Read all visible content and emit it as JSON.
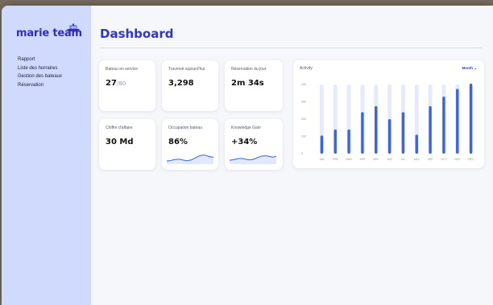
{
  "app": {
    "logo": "marie team"
  },
  "sidebar": {
    "items": [
      {
        "label": "Rapport"
      },
      {
        "label": "Liste des horraires"
      },
      {
        "label": "Gestion des bateaux"
      },
      {
        "label": "Réservation"
      }
    ]
  },
  "page": {
    "title": "Dashboard"
  },
  "cards": {
    "bateau": {
      "label": "Bateau en service",
      "value": "27",
      "sub": "/80"
    },
    "traverse": {
      "label": "Traversé aujourd'hui",
      "value": "3,298"
    },
    "reservation": {
      "label": "Réservation du jour",
      "value": "2m 34s"
    },
    "chiffre": {
      "label": "Chiffre d'affaire",
      "value": "30 Md"
    },
    "occupation": {
      "label": "Occupation bateau",
      "value": "86%"
    },
    "knowledge": {
      "label": "Knowledge Gain",
      "value": "+34%"
    }
  },
  "activity": {
    "title": "Activity",
    "period": "Month ⌄"
  },
  "colors": {
    "accent": "#2f36c8",
    "bar": "#3a63e6",
    "track": "#e6ebfb",
    "sidebar": "#cfdafd"
  },
  "chart_data": {
    "type": "bar",
    "categories": [
      "JAN",
      "FEB",
      "MAR",
      "APR",
      "MAY",
      "JUN",
      "JUL",
      "AUG",
      "SEP",
      "OCT",
      "NOV",
      "DEC"
    ],
    "values": [
      105,
      140,
      140,
      240,
      275,
      200,
      240,
      110,
      275,
      330,
      375,
      405
    ],
    "ylim": [
      0,
      400
    ],
    "yticks": [
      0,
      100,
      200,
      300,
      400
    ],
    "grid": false
  }
}
